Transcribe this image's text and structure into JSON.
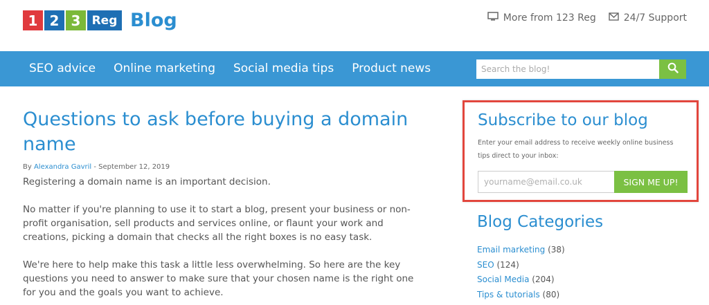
{
  "logo": {
    "digit1": "1",
    "digit2": "2",
    "digit3": "3",
    "reg": "Reg",
    "blog": "Blog"
  },
  "toplinks": {
    "more": "More from 123 Reg",
    "support": "24/7 Support"
  },
  "nav": {
    "items": [
      "SEO advice",
      "Online marketing",
      "Social media tips",
      "Product news"
    ]
  },
  "search": {
    "placeholder": "Search the blog!"
  },
  "article": {
    "title": "Questions to ask before buying a domain name",
    "by": "By",
    "author": "Alexandra Gavril",
    "date": " - September 12, 2019",
    "paragraphs": [
      "Registering a domain name is an important decision.",
      "No matter if you're planning to use it to start a blog, present your business or non-profit organisation, sell products and services online, or flaunt your work and creations, picking a domain that checks all the right boxes is no easy task.",
      "We're here to help make this task a little less overwhelming. So here are the key questions you need to answer to make sure that your chosen name is the right one for you and the goals you want to achieve."
    ]
  },
  "subscribe": {
    "title": "Subscribe to our blog",
    "description": "Enter your email address to receive weekly online business tips direct to your inbox:",
    "placeholder": "yourname@email.co.uk",
    "button": "SIGN ME UP!",
    "highlight_color": "#e2463d"
  },
  "categories": {
    "title": "Blog Categories",
    "items": [
      {
        "label": "Email marketing",
        "count": "(38)"
      },
      {
        "label": "SEO",
        "count": "(124)"
      },
      {
        "label": "Social Media",
        "count": "(204)"
      },
      {
        "label": "Tips & tutorials",
        "count": "(80)"
      }
    ]
  },
  "colors": {
    "brand_blue": "#3a97d4",
    "accent_green": "#7bc043",
    "link_blue": "#2b8ed0"
  }
}
